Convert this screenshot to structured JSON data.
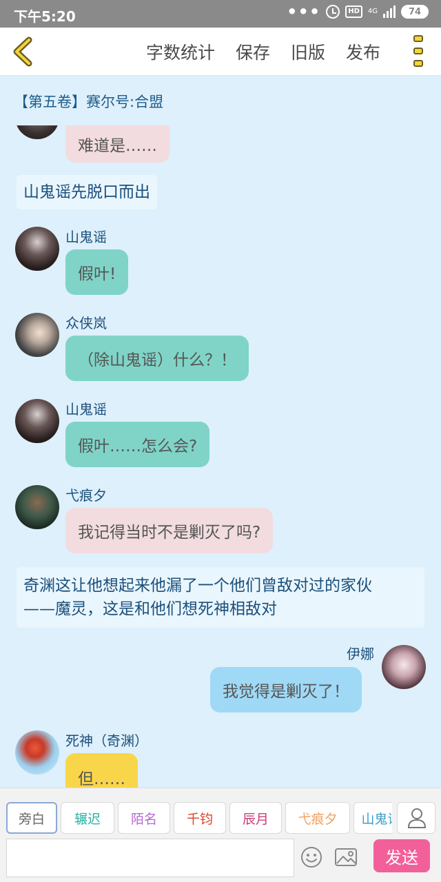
{
  "status_bar": {
    "time": "下午5:20",
    "hd": "HD",
    "network": "4G",
    "battery": "74"
  },
  "toolbar": {
    "word_count": "字数统计",
    "save": "保存",
    "old_version": "旧版",
    "publish": "发布"
  },
  "chapter_title": "【第五卷】赛尔号:合盟",
  "messages": [
    {
      "text": "难道是……"
    },
    {
      "narration": "山鬼谣先脱口而出"
    },
    {
      "sender": "山鬼谣",
      "text": "假叶!"
    },
    {
      "sender": "众侠岚",
      "text": "（除山鬼谣）什么？！"
    },
    {
      "sender": "山鬼谣",
      "text": "假叶……怎么会?"
    },
    {
      "sender": "弋痕夕",
      "text": "我记得当时不是剿灭了吗?"
    },
    {
      "narration_lines": [
        "奇渊这让他想起来他漏了一个他们曾敌对过的家伙",
        "——魔灵，这是和他们想死神相敌对"
      ]
    },
    {
      "sender": "伊娜",
      "text": "我觉得是剿灭了！"
    },
    {
      "sender": "死神（奇渊）",
      "text": "但……"
    }
  ],
  "characters": [
    {
      "name": "旁白",
      "color": "#666666"
    },
    {
      "name": "辗迟",
      "color": "#2bb3a3"
    },
    {
      "name": "陌名",
      "color": "#b36ad0"
    },
    {
      "name": "千钧",
      "color": "#d9432c"
    },
    {
      "name": "辰月",
      "color": "#c8407a"
    },
    {
      "name": "弋痕夕",
      "color": "#f0a060"
    },
    {
      "name": "山鬼谣",
      "color": "#3aa0c8"
    }
  ],
  "composer": {
    "input_value": "",
    "send": "发送"
  },
  "icons": [
    "back-arrow-icon",
    "menu-icon",
    "person-icon",
    "emoji-icon",
    "image-icon",
    "alarm-icon",
    "signal-icon",
    "battery-icon"
  ]
}
